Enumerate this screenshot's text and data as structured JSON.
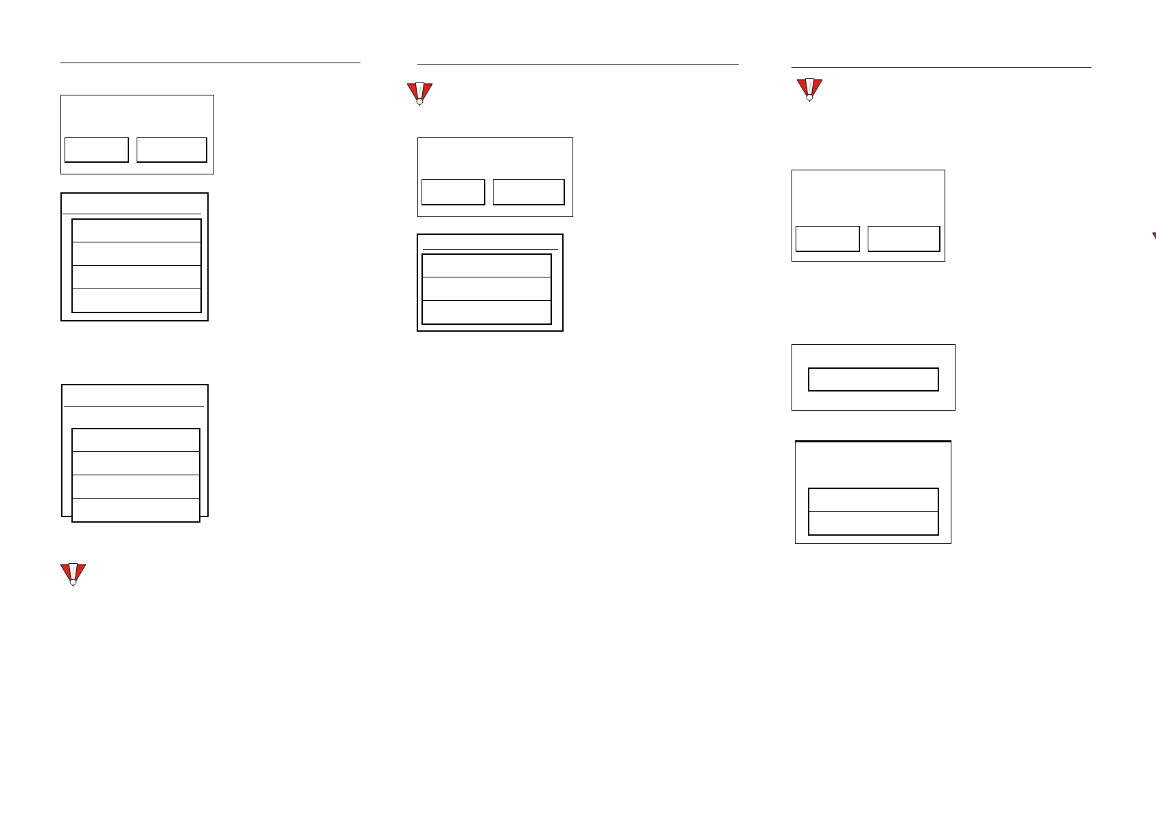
{
  "columns": [
    {
      "blocks": [
        {
          "kind": "rule"
        },
        {
          "kind": "dialog",
          "buttons": [
            {
              "kind": "button"
            },
            {
              "kind": "button"
            }
          ]
        },
        {
          "kind": "list_screen",
          "title_rule": true,
          "rows": [
            {
              "kind": "row"
            },
            {
              "kind": "row"
            },
            {
              "kind": "row"
            },
            {
              "kind": "row"
            }
          ]
        },
        {
          "kind": "list_screen",
          "title_rule": true,
          "rows": [
            {
              "kind": "row"
            },
            {
              "kind": "row"
            },
            {
              "kind": "row"
            },
            {
              "kind": "row"
            }
          ]
        },
        {
          "kind": "warning"
        }
      ]
    },
    {
      "blocks": [
        {
          "kind": "rule"
        },
        {
          "kind": "warning"
        },
        {
          "kind": "dialog",
          "buttons": [
            {
              "kind": "button"
            },
            {
              "kind": "button"
            }
          ]
        },
        {
          "kind": "list_screen",
          "title_rule": true,
          "rows": [
            {
              "kind": "row"
            },
            {
              "kind": "row"
            },
            {
              "kind": "row"
            }
          ]
        }
      ]
    },
    {
      "blocks": [
        {
          "kind": "rule"
        },
        {
          "kind": "warning"
        },
        {
          "kind": "dialog",
          "buttons": [
            {
              "kind": "button"
            },
            {
              "kind": "button"
            }
          ]
        },
        {
          "kind": "entry_screen",
          "fields": [
            {
              "kind": "field"
            }
          ]
        },
        {
          "kind": "list_screen",
          "title_rule": false,
          "rows": [
            {
              "kind": "row"
            },
            {
              "kind": "row"
            }
          ]
        }
      ]
    },
    {
      "blocks": [
        {
          "kind": "warning_cut"
        }
      ]
    }
  ]
}
